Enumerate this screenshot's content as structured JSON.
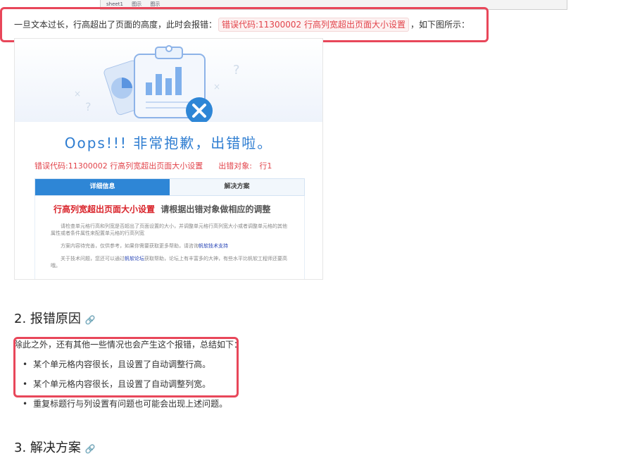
{
  "top_sliver": {
    "items": [
      "sheet1",
      "图示",
      "图示"
    ]
  },
  "paragraph": {
    "before": "一旦文本过长，行高超出了页面的高度，此时会报错：",
    "code": "错误代码:11300002 行高列宽超出页面大小设置",
    "after": "，如下图所示："
  },
  "error_image": {
    "oops": "Oops!!! 非常抱歉，出错啦。",
    "error_code": "错误代码:11300002 行高列宽超出页面大小设置",
    "error_object_label": "出错对象:",
    "error_object_value": "行1",
    "tab_details": "详细信息",
    "tab_solution": "解决方案",
    "panel_title_red": "行高列宽超出页面大小设置",
    "panel_title_dark": "请根据出错对象做相应的调整",
    "p1": "请检查单元格行高和列宽是否超出了页面设置的大小，并调整单元格行高列宽大小或者调整单元格的其他属性或者条件属性来配置单元格的行高列宽",
    "p2_before": "方案内容待完善，仅供参考，如果你需要获取更多帮助，请咨询",
    "p2_link": "帆软技术支持",
    "p3_before": "关于技术问题，您还可以通过",
    "p3_link": "帆软论坛",
    "p3_after": "获取帮助，论坛上有丰富多的大神，有些水平比帆软工程师还要高哦。"
  },
  "section2": {
    "heading": "2. 报错原因",
    "intro": "除此之外，还有其他一些情况也会产生这个报错，总结如下：",
    "bullets": [
      "某个单元格内容很长，且设置了自动调整行高。",
      "某个单元格内容很长，且设置了自动调整列宽。",
      "重复标题行与列设置有问题也可能会出现上述问题。"
    ]
  },
  "section3": {
    "heading": "3. 解决方案"
  },
  "colors": {
    "accent_blue": "#2e86d6",
    "error_red": "#e2444b",
    "highlight_box": "#e8475a"
  }
}
